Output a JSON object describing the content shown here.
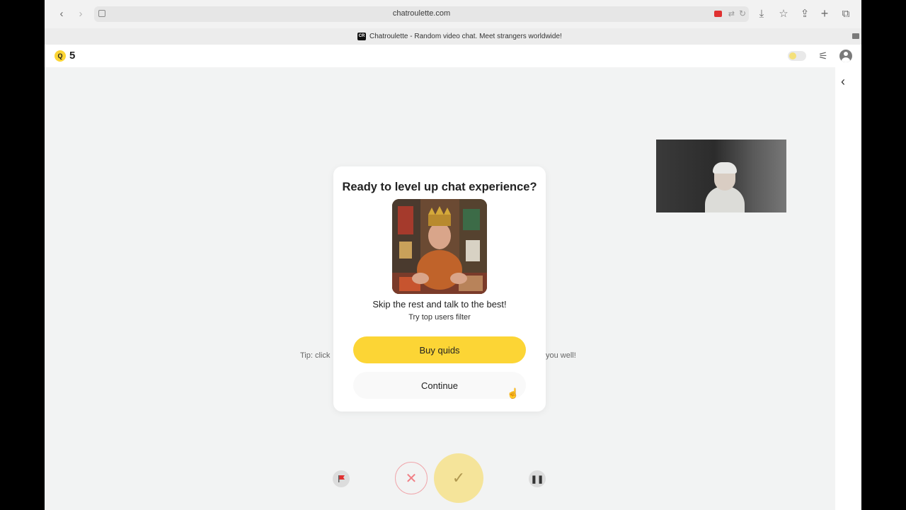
{
  "browser": {
    "url": "chatroulette.com",
    "tab_title": "Chatroulette - Random video chat. Meet strangers worldwide!",
    "tab_favicon_text": "CR"
  },
  "header": {
    "coin_symbol": "Q",
    "coin_count": "5",
    "accent_color": "#fcd535"
  },
  "background_tip": {
    "left_text": "Tip: click",
    "right_text": "you well!"
  },
  "modal": {
    "title": "Ready to level up chat experience?",
    "subtitle": "Skip the rest and talk to the best!",
    "subtitle2": "Try top users filter",
    "buy_label": "Buy quids",
    "continue_label": "Continue"
  },
  "icons": {
    "back": "‹",
    "forward": "›",
    "download": "⤓",
    "star": "☆",
    "share": "⇪",
    "new_tab": "+",
    "tabs": "⧉",
    "filter": "⚟",
    "collapse": "‹",
    "skip": "✕",
    "accept": "✓",
    "pause": "❚❚"
  }
}
